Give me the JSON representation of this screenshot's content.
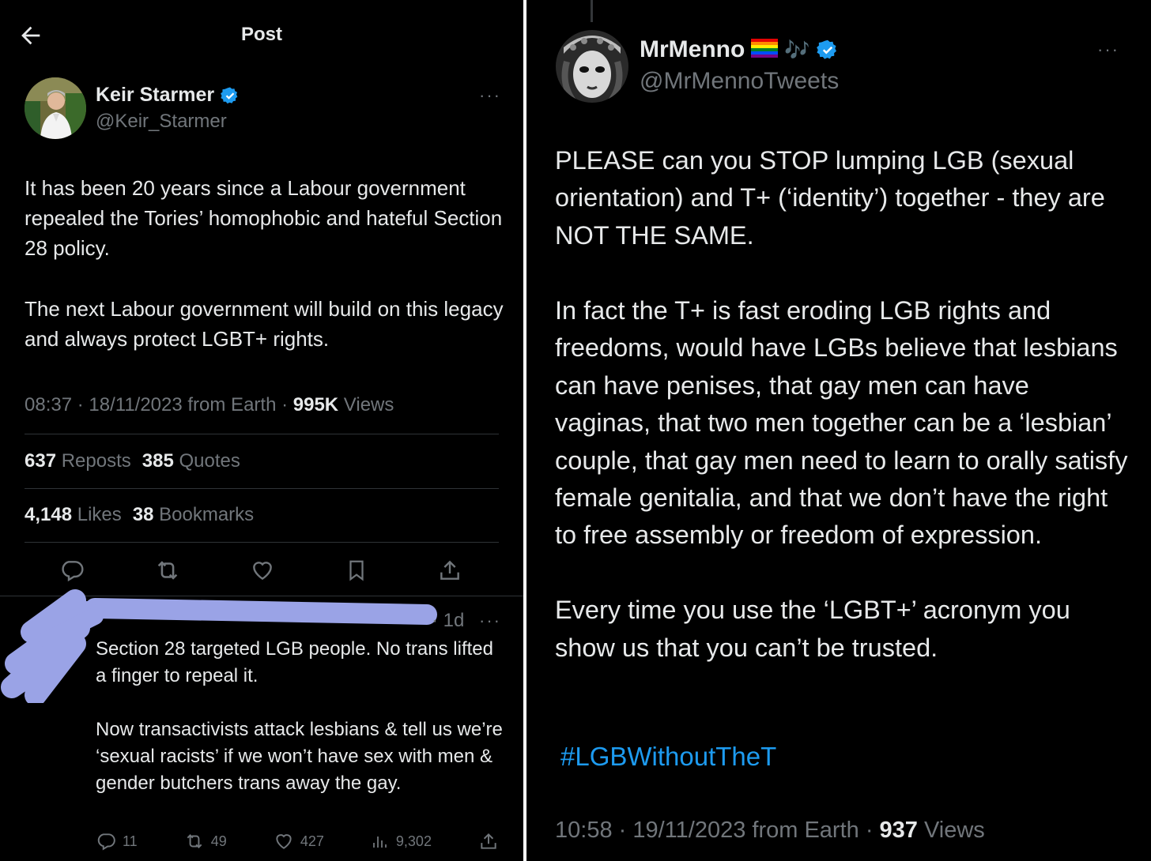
{
  "left": {
    "header": {
      "title": "Post"
    },
    "tweet": {
      "author_name": "Keir Starmer",
      "author_handle": "@Keir_Starmer",
      "more": "···",
      "text": "It has been 20 years since a Labour government repealed the Tories’ homophobic and hateful Section 28 policy.\n\nThe next Labour government will build on this legacy and always protect LGBT+ rights.",
      "meta_time": "08:37 · 18/11/2023 from Earth · ",
      "views_count": "995K",
      "views_label": " Views",
      "reposts_count": "637",
      "reposts_label": "Reposts",
      "quotes_count": "385",
      "quotes_label": "Quotes",
      "likes_count": "4,148",
      "likes_label": "Likes",
      "bookmarks_count": "38",
      "bookmarks_label": "Bookmarks"
    },
    "reply": {
      "time": "· 1d",
      "more": "···",
      "text": "Section 28 targeted LGB people. No trans lifted a finger to repeal it.\n\nNow transactivists attack lesbians & tell us we’re ‘sexual racists’ if we won’t have sex with men & gender butchers trans away the gay.",
      "replies": "11",
      "reposts": "49",
      "likes": "427",
      "views": "9,302"
    }
  },
  "right": {
    "tweet": {
      "author_name": "MrMenno",
      "author_handle": "@MrMennoTweets",
      "name_emojis": "🎶",
      "more": "···",
      "text": "PLEASE can you STOP lumping LGB (sexual orientation) and T+ (‘identity’) together - they are NOT THE SAME.\n\nIn fact the T+ is fast eroding LGB rights and freedoms, would have LGBs believe that lesbians can have penises, that gay men can have vaginas, that two men together can be a ‘lesbian’ couple, that gay men need to learn to orally satisfy female genitalia, and that we don’t have the right to free assembly or freedom of expression.\n\nEvery time you use the ‘LGBT+’ acronym you show us that you can’t be trusted.",
      "hashtag": "#LGBWithoutTheT",
      "meta_time": "10:58 · 19/11/2023 from Earth · ",
      "views_count": "937",
      "views_label": " Views"
    }
  },
  "colors": {
    "background": "#000000",
    "text": "#e7e9ea",
    "secondary": "#71767b",
    "accent": "#1d9bf0",
    "divider": "#2f3336",
    "redaction": "#9aa3e6"
  }
}
